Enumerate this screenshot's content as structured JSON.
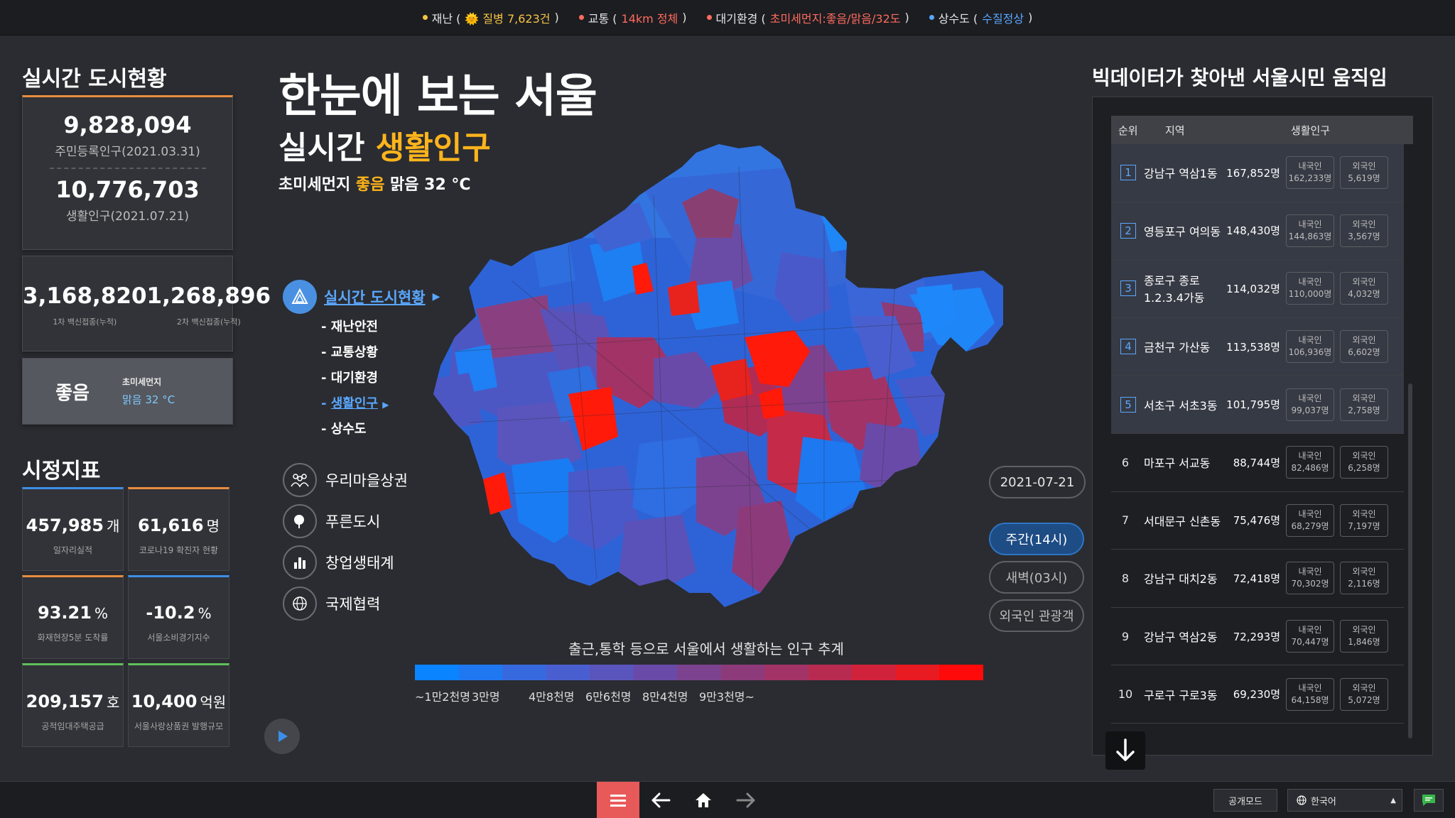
{
  "topbar": {
    "items": [
      {
        "label": "재난 (",
        "highlight": "🌞 질병 7,623건",
        "suffix": " )",
        "color": "#f6c343"
      },
      {
        "label": "교통 (",
        "highlight": "14km 정체",
        "suffix": ")",
        "color": "#ff6b5d"
      },
      {
        "label": "대기환경 (",
        "highlight": "초미세먼지:좋음/맑음/32도",
        "suffix": ")",
        "color": "#ff6b5d"
      },
      {
        "label": "상수도 (",
        "highlight": "수질정상",
        "suffix": ")",
        "color": "#5aa7ff"
      }
    ]
  },
  "left": {
    "title": "실시간 도시현황",
    "resident_pop": "9,828,094",
    "resident_label": "주민등록인구(2021.03.31)",
    "living_pop": "10,776,703",
    "living_label": "생활인구(2021.07.21)",
    "vaccine1": "3,168,820",
    "vaccine1_label": "1차 백신접종(누적)",
    "vaccine2": "1,268,896",
    "vaccine2_label": "2차 백신접종(누적)",
    "air_status": "좋음",
    "air_title": "초미세먼지",
    "air_value": "맑음 32 °C",
    "metrics_title": "시정지표",
    "metrics": [
      {
        "value": "457,985",
        "unit": "개",
        "label": "일자리실적",
        "color": "#3d8ee8"
      },
      {
        "value": "61,616",
        "unit": "명",
        "label": "코로나19 확진자 현황",
        "color": "#e98c3f"
      },
      {
        "value": "93.21",
        "unit": "%",
        "label": "화재현장5분 도착률",
        "color": "#e98c3f"
      },
      {
        "value": "-10.2",
        "unit": "%",
        "label": "서울소비경기지수",
        "color": "#3d8ee8"
      },
      {
        "value": "209,157",
        "unit": "호",
        "label": "공적임대주택공급",
        "color": "#5fbf5a"
      },
      {
        "value": "10,400",
        "unit": "억원",
        "label": "서울사랑상품권 발행규모",
        "color": "#5fbf5a"
      }
    ]
  },
  "center": {
    "title": "한눈에 보는 서울",
    "subtitle_prefix": "실시간 ",
    "subtitle_highlight": "생활인구",
    "weather_prefix": "초미세먼지 ",
    "weather_highlight": "좋음",
    "weather_suffix": " 맑음 32 °C",
    "nav_main": "실시간 도시현황",
    "subnav": [
      "재난안전",
      "교통상황",
      "대기환경",
      "생활인구",
      "상수도"
    ],
    "nav_other": [
      "우리마을상권",
      "푸른도시",
      "창업생태계",
      "국제협력"
    ],
    "date": "2021-07-21",
    "time_buttons": [
      "주간(14시)",
      "새벽(03시)",
      "외국인 관광객"
    ],
    "legend_title": "출근,통학 등으로 서울에서 생활하는 인구 추계",
    "legend_ticks": [
      "~1만2천명",
      "3만명",
      "4만8천명",
      "6만6천명",
      "8만4천명",
      "9만3천명~"
    ],
    "legend_colors": [
      "#0a84ff",
      "#1f78f0",
      "#3769de",
      "#4a5fcf",
      "#5a55bc",
      "#6a4aa8",
      "#7c4290",
      "#8d3a7a",
      "#a23366",
      "#b82b50",
      "#d0223a",
      "#e81a22",
      "#ff0a0a"
    ]
  },
  "right": {
    "title": "빅데이터가 찾아낸 서울시민 움직임",
    "headers": [
      "순위",
      "지역",
      "생활인구"
    ],
    "native_label": "내국인",
    "foreign_label": "외국인",
    "rows": [
      {
        "rank": "1",
        "area": "강남구 역삼1동",
        "count": "167,852명",
        "native": "162,233명",
        "foreign": "5,619명"
      },
      {
        "rank": "2",
        "area": "영등포구 여의동",
        "count": "148,430명",
        "native": "144,863명",
        "foreign": "3,567명"
      },
      {
        "rank": "3",
        "area": "종로구 종로1.2.3.4가동",
        "count": "114,032명",
        "native": "110,000명",
        "foreign": "4,032명"
      },
      {
        "rank": "4",
        "area": "금천구 가산동",
        "count": "113,538명",
        "native": "106,936명",
        "foreign": "6,602명"
      },
      {
        "rank": "5",
        "area": "서초구 서초3동",
        "count": "101,795명",
        "native": "99,037명",
        "foreign": "2,758명"
      },
      {
        "rank": "6",
        "area": "마포구 서교동",
        "count": "88,744명",
        "native": "82,486명",
        "foreign": "6,258명"
      },
      {
        "rank": "7",
        "area": "서대문구 신촌동",
        "count": "75,476명",
        "native": "68,279명",
        "foreign": "7,197명"
      },
      {
        "rank": "8",
        "area": "강남구 대치2동",
        "count": "72,418명",
        "native": "70,302명",
        "foreign": "2,116명"
      },
      {
        "rank": "9",
        "area": "강남구 역삼2동",
        "count": "72,293명",
        "native": "70,447명",
        "foreign": "1,846명"
      },
      {
        "rank": "10",
        "area": "구로구 구로3동",
        "count": "69,230명",
        "native": "64,158명",
        "foreign": "5,072명"
      }
    ]
  },
  "bottom": {
    "public_mode": "공개모드",
    "language": "한국어"
  }
}
